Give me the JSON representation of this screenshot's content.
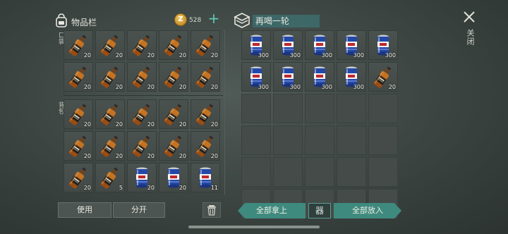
{
  "inventory": {
    "title": "物品栏",
    "coins": "528",
    "coin_symbol": "Z",
    "pocket_label": "口袋",
    "backpack_label": "背包",
    "pocket_slots": [
      {
        "item": "whiskey-bottle",
        "qty": "20"
      },
      {
        "item": "whiskey-bottle",
        "qty": "20"
      },
      {
        "item": "whiskey-bottle",
        "qty": "20"
      },
      {
        "item": "whiskey-bottle",
        "qty": "20"
      },
      {
        "item": "whiskey-bottle",
        "qty": "20"
      },
      {
        "item": "whiskey-bottle",
        "qty": "20"
      },
      {
        "item": "whiskey-bottle",
        "qty": "20"
      },
      {
        "item": "whiskey-bottle",
        "qty": "20"
      },
      {
        "item": "whiskey-bottle",
        "qty": "20"
      },
      {
        "item": "whiskey-bottle",
        "qty": "20"
      }
    ],
    "backpack_slots": [
      {
        "item": "whiskey-bottle",
        "qty": "20"
      },
      {
        "item": "whiskey-bottle",
        "qty": "20"
      },
      {
        "item": "whiskey-bottle",
        "qty": "20"
      },
      {
        "item": "whiskey-bottle",
        "qty": "20"
      },
      {
        "item": "whiskey-bottle",
        "qty": "20"
      },
      {
        "item": "whiskey-bottle",
        "qty": "20"
      },
      {
        "item": "whiskey-bottle",
        "qty": "20"
      },
      {
        "item": "whiskey-bottle",
        "qty": "20"
      },
      {
        "item": "whiskey-bottle",
        "qty": "20"
      },
      {
        "item": "whiskey-bottle",
        "qty": "20"
      },
      {
        "item": "whiskey-bottle",
        "qty": "20"
      },
      {
        "item": "whiskey-bottle",
        "qty": "5"
      },
      {
        "item": "beer-can",
        "qty": "20"
      },
      {
        "item": "beer-can",
        "qty": "20"
      },
      {
        "item": "beer-can",
        "qty": "11"
      }
    ]
  },
  "container": {
    "title": "再喝一轮",
    "slots": [
      {
        "item": "beer-can",
        "qty": "300"
      },
      {
        "item": "beer-can",
        "qty": "300"
      },
      {
        "item": "beer-can",
        "qty": "300"
      },
      {
        "item": "beer-can",
        "qty": "300"
      },
      {
        "item": "beer-can",
        "qty": "300"
      },
      {
        "item": "beer-can",
        "qty": "300"
      },
      {
        "item": "beer-can",
        "qty": "300"
      },
      {
        "item": "beer-can",
        "qty": "300"
      },
      {
        "item": "beer-can",
        "qty": "300"
      },
      {
        "item": "whiskey-bottle",
        "qty": "20"
      },
      null,
      null,
      null,
      null,
      null,
      null,
      null,
      null,
      null,
      null,
      null,
      null,
      null,
      null,
      null,
      null,
      null,
      null,
      null,
      null
    ]
  },
  "actions": {
    "use": "使用",
    "split": "分开",
    "take_all": "全部拿上",
    "sort": "器",
    "put_all": "全部放入",
    "close": "关闭"
  },
  "icons": {
    "bag": "backpack-icon",
    "box": "container-box-icon",
    "close": "close-icon",
    "trash": "trash-icon",
    "add": "plus-icon"
  },
  "colors": {
    "accent": "#3f8a7e",
    "container_title_bg": "#3e6868",
    "add": "#5fc9b4"
  }
}
